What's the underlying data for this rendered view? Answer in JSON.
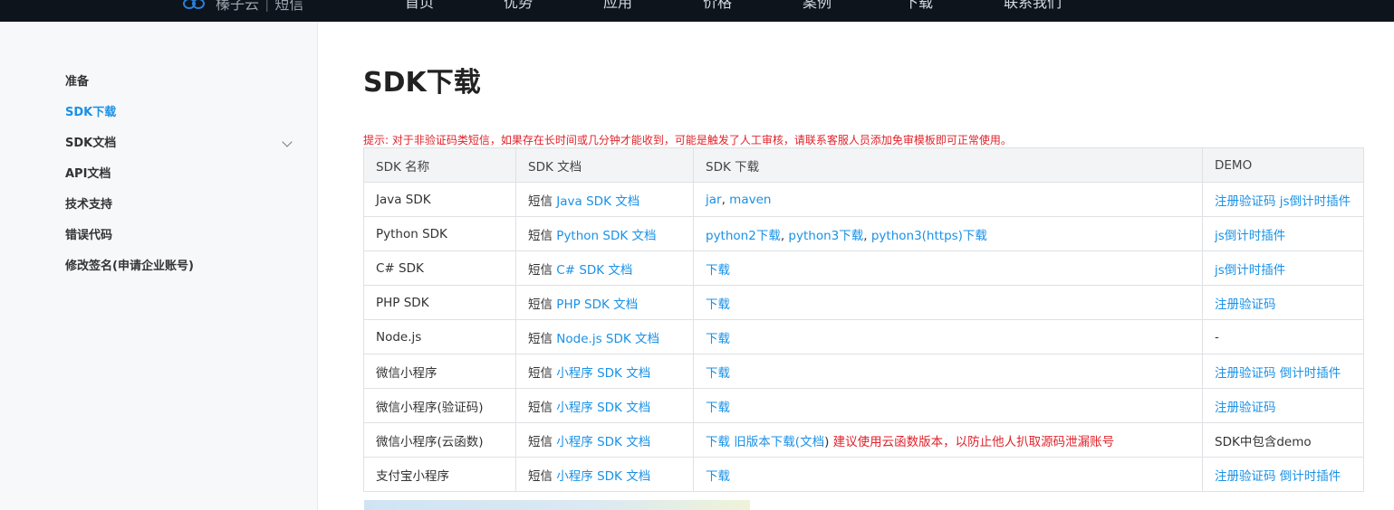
{
  "header": {
    "brand": "榛子云",
    "brand_sub": "短信",
    "nav": [
      "首页",
      "优势",
      "应用",
      "价格",
      "案例",
      "下载",
      "联系我们"
    ]
  },
  "sidebar": {
    "items": [
      "准备",
      "SDK下载",
      "SDK文档",
      "API文档",
      "技术支持",
      "错误代码",
      "修改签名(申请企业账号)"
    ],
    "active": "SDK下载"
  },
  "main": {
    "title": "SDK下载",
    "tip_prefix": "提示:",
    "tip": "对于非验证码类短信，如果存在长时间或几分钟才能收到，可能是触发了人工审核，请联系客服人员添加免审模板即可正常使用。",
    "table": {
      "headers": [
        "SDK 名称",
        "SDK 文档",
        "SDK 下载",
        "DEMO"
      ],
      "doc_prefix": "短信",
      "rows": [
        {
          "name": "Java SDK",
          "doc": "Java SDK 文档",
          "downloads": [
            {
              "t": "jar",
              "link": true
            },
            {
              "t": ", ",
              "link": false
            },
            {
              "t": "maven",
              "link": true
            }
          ],
          "demo": [
            {
              "t": "注册验证码",
              "link": true
            },
            {
              "t": " ",
              "link": false
            },
            {
              "t": "js倒计时插件",
              "link": true
            }
          ]
        },
        {
          "name": "Python SDK",
          "doc": "Python SDK 文档",
          "downloads": [
            {
              "t": "python2下载",
              "link": true
            },
            {
              "t": ", ",
              "link": false
            },
            {
              "t": "python3下载",
              "link": true
            },
            {
              "t": ", ",
              "link": false
            },
            {
              "t": "python3(https)下载",
              "link": true
            }
          ],
          "demo": [
            {
              "t": "js倒计时插件",
              "link": true
            }
          ]
        },
        {
          "name": "C# SDK",
          "doc": "C# SDK 文档",
          "downloads": [
            {
              "t": "下载",
              "link": true
            }
          ],
          "demo": [
            {
              "t": "js倒计时插件",
              "link": true
            }
          ]
        },
        {
          "name": "PHP SDK",
          "doc": "PHP SDK 文档",
          "downloads": [
            {
              "t": "下载",
              "link": true
            }
          ],
          "demo": [
            {
              "t": "注册验证码",
              "link": true
            }
          ]
        },
        {
          "name": "Node.js",
          "doc": "Node.js SDK 文档",
          "downloads": [
            {
              "t": "下载",
              "link": true
            }
          ],
          "demo": [
            {
              "t": "-",
              "link": false
            }
          ]
        },
        {
          "name": "微信小程序",
          "doc": "小程序 SDK 文档",
          "downloads": [
            {
              "t": "下载",
              "link": true
            }
          ],
          "demo": [
            {
              "t": "注册验证码",
              "link": true
            },
            {
              "t": " ",
              "link": false
            },
            {
              "t": "倒计时插件",
              "link": true
            }
          ]
        },
        {
          "name": "微信小程序(验证码)",
          "doc": "小程序 SDK 文档",
          "downloads": [
            {
              "t": "下载",
              "link": true
            }
          ],
          "demo": [
            {
              "t": "注册验证码",
              "link": true
            }
          ]
        },
        {
          "name": "微信小程序(云函数)",
          "doc": "小程序 SDK 文档",
          "downloads": [
            {
              "t": "下载",
              "link": true
            },
            {
              "t": " ",
              "link": false
            },
            {
              "t": "旧版本下载(文档",
              "link": true
            },
            {
              "t": ") ",
              "link": false
            },
            {
              "t": "建议使用云函数版本，以防止他人扒取源码泄漏账号",
              "link": false,
              "red": true
            }
          ],
          "demo": [
            {
              "t": "SDK中包含demo",
              "link": false
            }
          ]
        },
        {
          "name": "支付宝小程序",
          "doc": "小程序 SDK 文档",
          "downloads": [
            {
              "t": "下载",
              "link": true
            }
          ],
          "demo": [
            {
              "t": "注册验证码",
              "link": true
            },
            {
              "t": " ",
              "link": false
            },
            {
              "t": "倒计时插件",
              "link": true
            }
          ]
        }
      ]
    }
  },
  "colors": {
    "nav_bg": "#0d141c",
    "link": "#1a91e6",
    "warning": "#e0222a",
    "sidebar_bg": "#f7f8f9"
  }
}
